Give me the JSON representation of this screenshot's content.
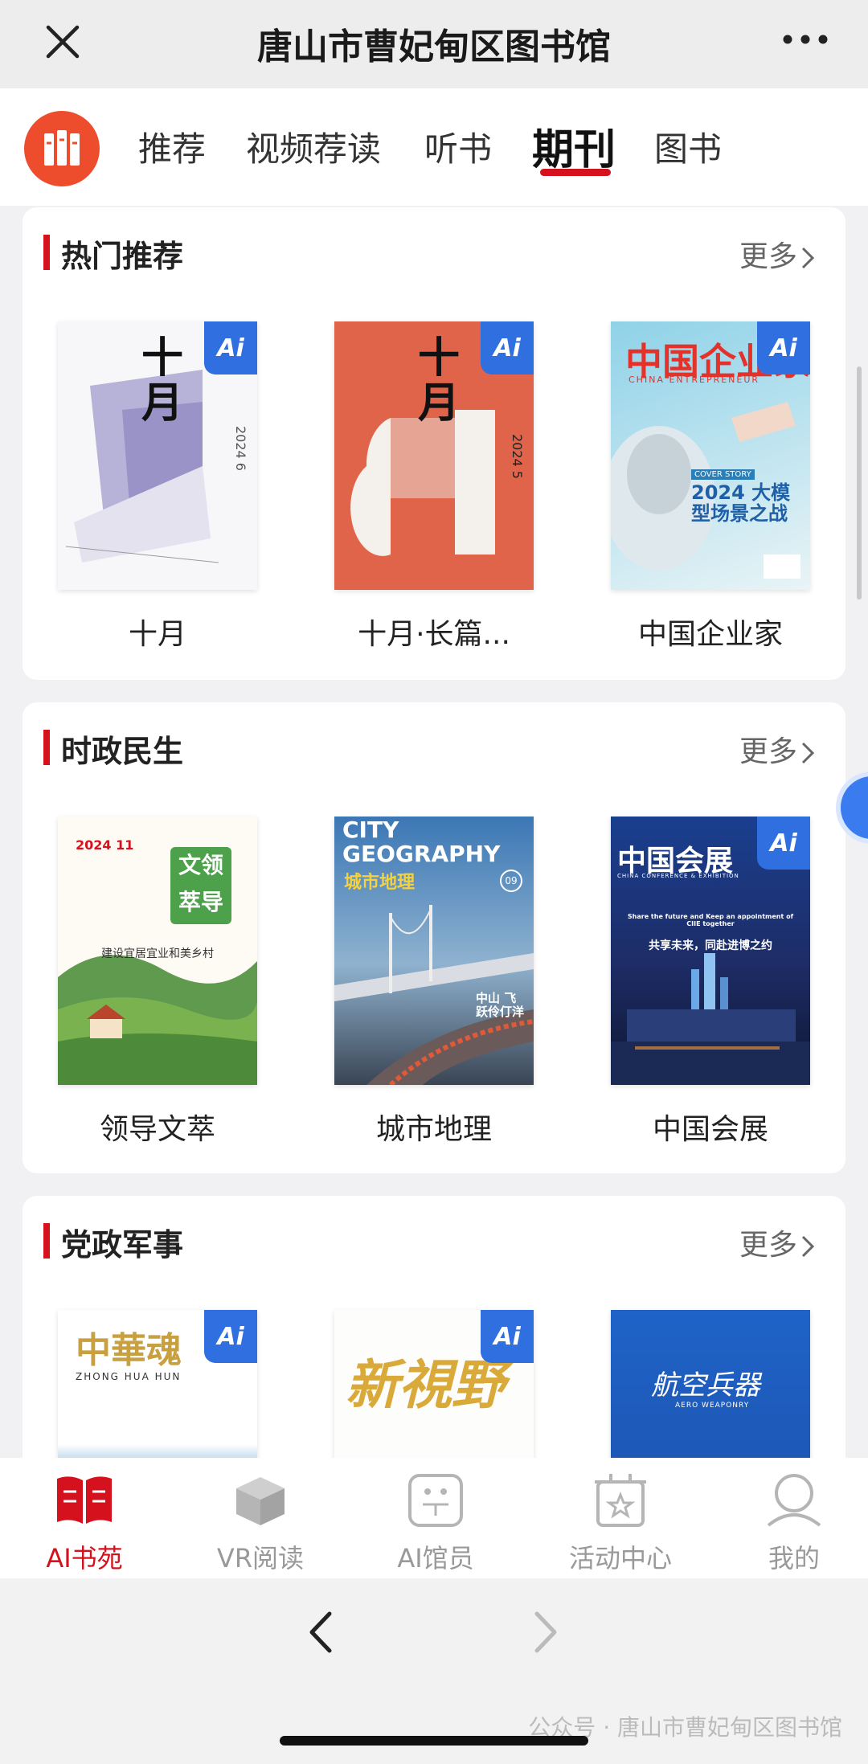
{
  "header": {
    "title": "唐山市曹妃甸区图书馆"
  },
  "tabs": [
    {
      "label": "推荐"
    },
    {
      "label": "视频荐读"
    },
    {
      "label": "听书"
    },
    {
      "label": "期刊",
      "active": true
    },
    {
      "label": "图书"
    }
  ],
  "sections": [
    {
      "title": "热门推荐",
      "more": "更多",
      "books": [
        {
          "name": "十月",
          "cover_title": "十月",
          "cover_issue": "2024 6",
          "ai": true
        },
        {
          "name": "十月·长篇...",
          "cover_title": "十月",
          "cover_issue": "2024 5",
          "ai": true
        },
        {
          "name": "中国企业家",
          "cover_title": "中国企业家",
          "cover_sub": "CHINA ENTREPRENEUR",
          "cover_headline": "2024 大模型场景之战",
          "cover_story": "COVER STORY",
          "ai": true
        }
      ]
    },
    {
      "title": "时政民生",
      "more": "更多",
      "books": [
        {
          "name": "领导文萃",
          "cover_badge_1": "文领",
          "cover_badge_2": "萃导",
          "cover_issue": "2024 11",
          "cover_caption": "建设宜居宜业和美乡村",
          "ai": false
        },
        {
          "name": "城市地理",
          "cover_title_en": "CITY GEOGRAPHY",
          "cover_title_cn": "城市地理",
          "cover_issue": "09",
          "cover_caption": "中山 飞跃伶仃洋",
          "ai": false
        },
        {
          "name": "中国会展",
          "cover_title": "中国会展",
          "cover_sub": "CHINA CONFERENCE & EXHIBITION",
          "cover_caption_en": "Share the future and Keep an appointment of CIIE together",
          "cover_caption_cn": "共享未来，同赴进博之约",
          "ai": true
        }
      ]
    },
    {
      "title": "党政军事",
      "more": "更多",
      "books": [
        {
          "name": "中华魂",
          "cover_title": "中華魂",
          "cover_sub": "ZHONG HUA HUN",
          "ai": true
        },
        {
          "name": "新视野",
          "cover_title": "新視野",
          "ai": true
        },
        {
          "name": "航空兵器",
          "cover_title": "航空兵器",
          "cover_sub": "AERO WEAPONRY",
          "ai": false
        }
      ]
    }
  ],
  "bottom_nav": [
    {
      "label": "AI书苑",
      "icon": "book-icon",
      "active": true
    },
    {
      "label": "VR阅读",
      "icon": "cube-icon"
    },
    {
      "label": "AI馆员",
      "icon": "robot-icon"
    },
    {
      "label": "活动中心",
      "icon": "gift-icon"
    },
    {
      "label": "我的",
      "icon": "user-icon"
    }
  ],
  "ai_badge": "Ai",
  "watermark": "公众号 · 唐山市曹妃甸区图书馆",
  "colors": {
    "accent": "#d6111e",
    "ai_blue": "#2f6fe0",
    "logo": "#ee4d2d"
  }
}
